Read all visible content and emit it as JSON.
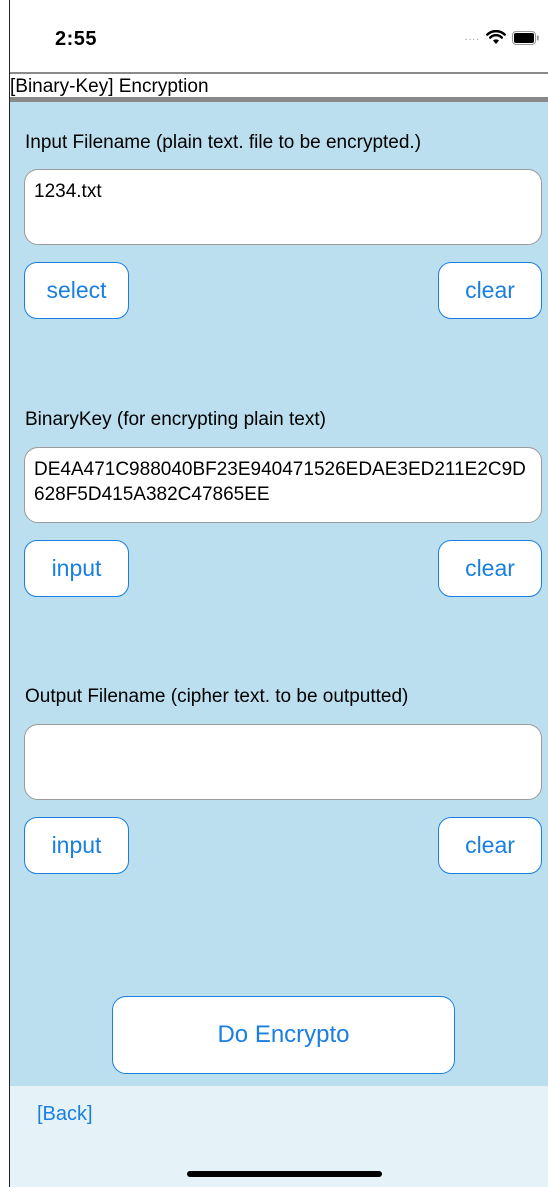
{
  "status_bar": {
    "time": "2:55",
    "signal_dots": "....",
    "wifi_icon": "wifi-icon",
    "battery_icon": "battery-icon"
  },
  "header": {
    "title": "[Binary-Key] Encryption"
  },
  "input_section": {
    "label": "Input Filename (plain text. file to be encrypted.)",
    "value": "1234.txt",
    "select_label": "select",
    "clear_label": "clear"
  },
  "key_section": {
    "label": "BinaryKey (for encrypting plain text)",
    "value": "DE4A471C988040BF23E940471526EDAE3ED211E2C9D628F5D415A382C47865EE",
    "input_label": "input",
    "clear_label": "clear"
  },
  "output_section": {
    "label": "Output Filename (cipher text. to be outputted)",
    "value": "",
    "input_label": "input",
    "clear_label": "clear"
  },
  "actions": {
    "do_encrypt_label": "Do Encrypto"
  },
  "footer": {
    "back_label": "[Back]"
  },
  "colors": {
    "accent": "#1a7fe0",
    "background": "#bcdff0",
    "footer_background": "#e5f3f9"
  }
}
